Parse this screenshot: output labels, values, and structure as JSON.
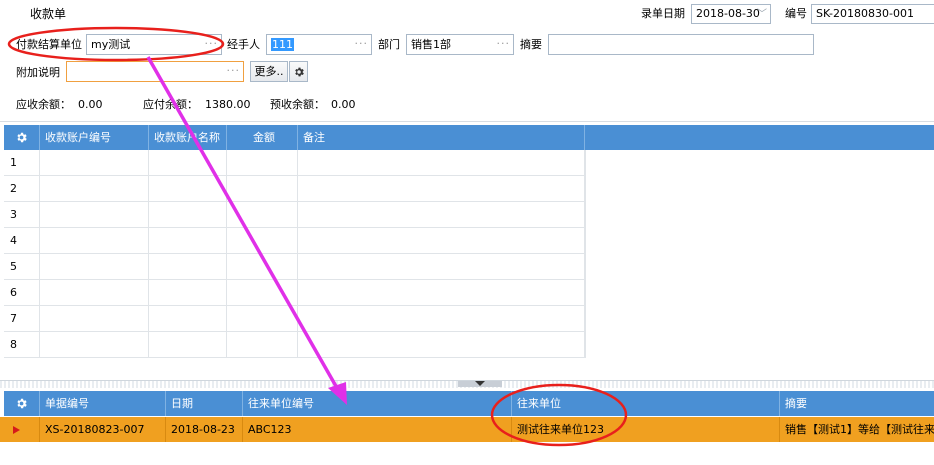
{
  "window": {
    "title": "收款单"
  },
  "header": {
    "date_label": "录单日期",
    "date_value": "2018-08-30",
    "number_label": "编号",
    "number_value": "SK-20180830-001"
  },
  "form": {
    "payer_label": "付款结算单位",
    "payer_value": "my测试",
    "handler_label": "经手人",
    "handler_value": "111",
    "dept_label": "部门",
    "dept_value": "销售1部",
    "summary_label": "摘要",
    "summary_value": "",
    "extra_label": "附加说明",
    "extra_value": "",
    "more_button": "更多..",
    "dots": "···"
  },
  "balances": {
    "receivable_label": "应收余额：",
    "receivable_value": "0.00",
    "payable_label": "应付余额：",
    "payable_value": "1380.00",
    "prepaid_label": "预收余额：",
    "prepaid_value": "0.00"
  },
  "upper_grid": {
    "columns": [
      "收款账户编号",
      "收款账户名称",
      "金额",
      "备注"
    ],
    "row_numbers": [
      "1",
      "2",
      "3",
      "4",
      "5",
      "6",
      "7",
      "8"
    ]
  },
  "lower_grid": {
    "columns": [
      "单据编号",
      "日期",
      "往来单位编号",
      "往来单位",
      "摘要"
    ],
    "rows": [
      {
        "doc_no": "XS-20180823-007",
        "date": "2018-08-23",
        "partner_code": "ABC123",
        "partner": "测试往来单位123",
        "summary": "销售【测试1】等给【测试往来单"
      }
    ]
  },
  "colors": {
    "header_blue": "#4a8fd4",
    "selected_row_orange": "#f0a020",
    "annotation_red": "#e8201c",
    "annotation_magenta": "#e030e8"
  }
}
